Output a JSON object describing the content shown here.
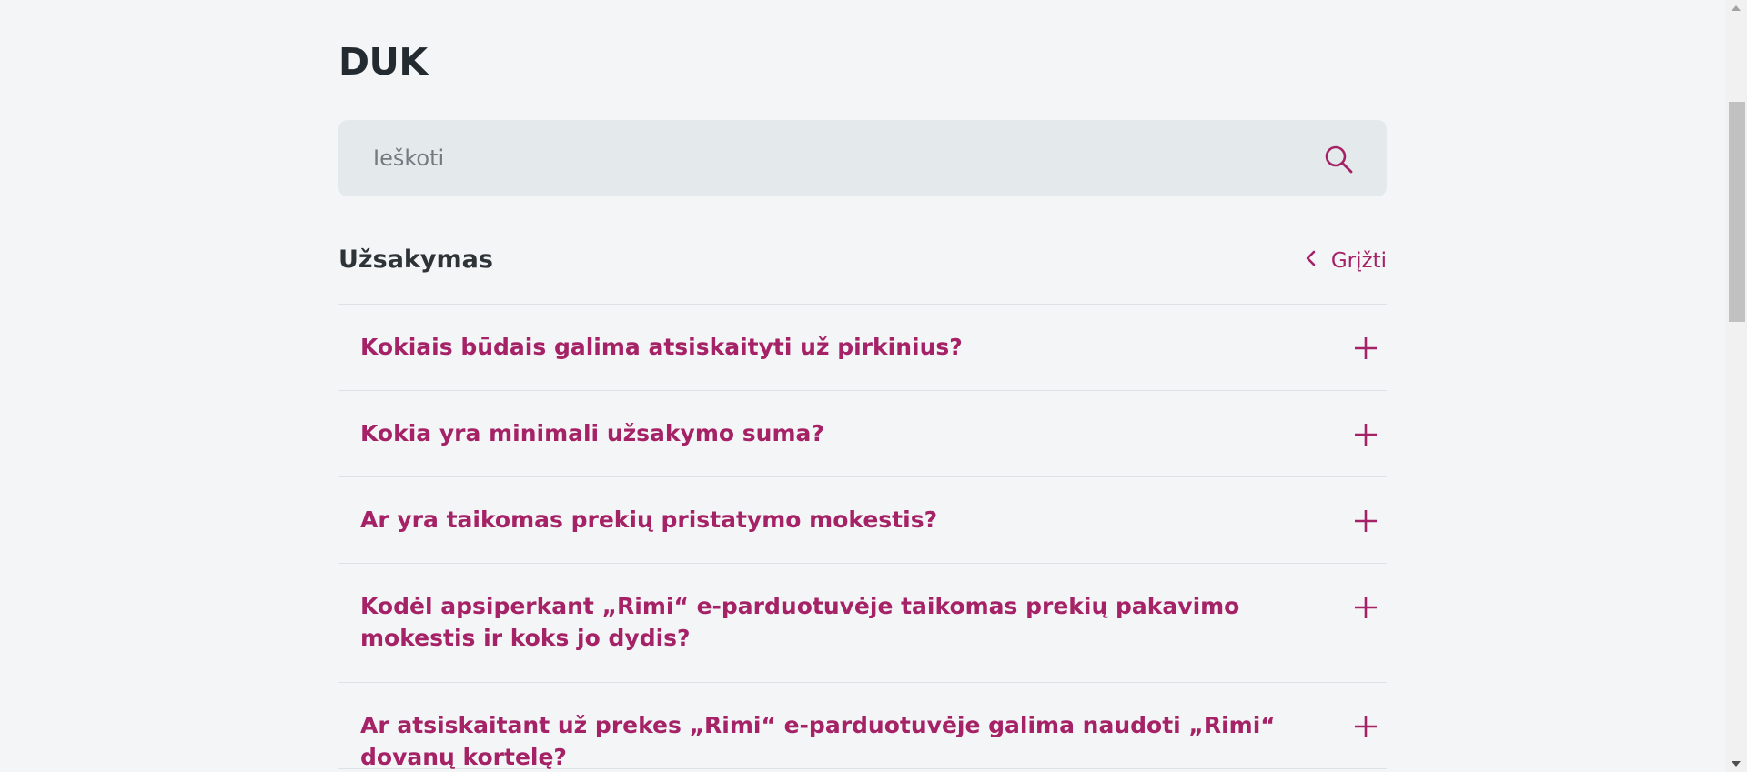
{
  "page": {
    "title": "DUK"
  },
  "search": {
    "placeholder": "Ieškoti",
    "icon": "search-icon"
  },
  "section": {
    "title": "Užsakymas",
    "back_label": "Grįžti",
    "back_icon": "chevron-left-icon"
  },
  "faq": {
    "items": [
      {
        "question": "Kokiais būdais galima atsiskaityti už pirkinius?",
        "icon": "plus-icon"
      },
      {
        "question": "Kokia yra minimali užsakymo suma?",
        "icon": "plus-icon"
      },
      {
        "question": "Ar yra taikomas prekių pristatymo mokestis?",
        "icon": "plus-icon"
      },
      {
        "question": "Kodėl apsiperkant „Rimi“ e-parduotuvėje taikomas prekių pakavimo mokestis ir koks jo dydis?",
        "icon": "plus-icon"
      },
      {
        "question": "Ar atsiskaitant už prekes „Rimi“ e-parduotuvėje galima naudoti „Rimi“ dovanų kortelę?",
        "icon": "plus-icon"
      }
    ]
  },
  "colors": {
    "background": "#f3f5f7",
    "accent": "#a52266",
    "search_bg": "#e4e9ec",
    "heading": "#232a30"
  }
}
